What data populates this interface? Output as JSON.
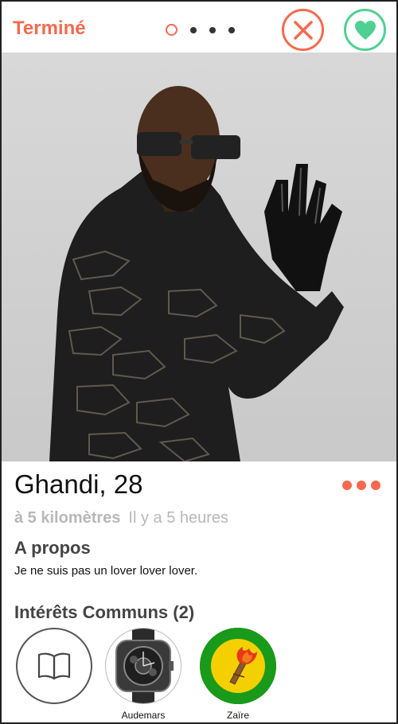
{
  "header": {
    "done_label": "Terminé",
    "page_indicator": {
      "total": 4,
      "current": 1
    }
  },
  "profile": {
    "name_age": "Ghandi, 28",
    "distance": "à 5 kilomètres",
    "last_seen": "Il y a 5 heures"
  },
  "about": {
    "title": "A propos",
    "text": "Je ne suis pas un lover lover lover."
  },
  "interests": {
    "title": "Intérêts Communs (2)",
    "items": [
      {
        "label": "",
        "icon": "book-icon"
      },
      {
        "label": "Audemars",
        "icon": "watch-icon"
      },
      {
        "label": "Zaïre",
        "icon": "zaire-flag-icon"
      }
    ]
  },
  "colors": {
    "accent": "#f46a4f",
    "like": "#4fd093",
    "zaire_green": "#1a9a1a",
    "zaire_yellow": "#f5d000"
  }
}
